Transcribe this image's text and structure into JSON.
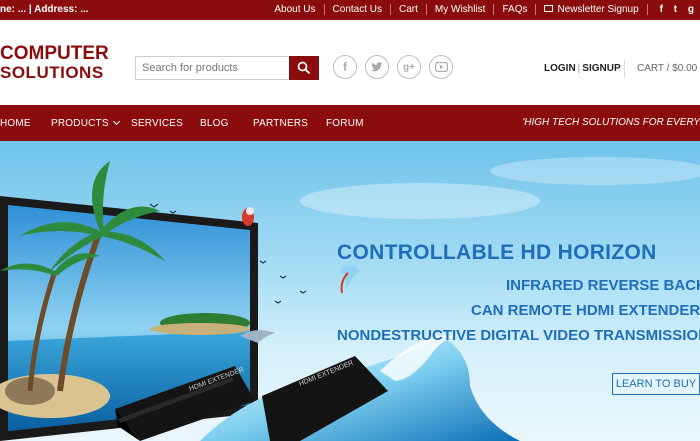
{
  "topbar": {
    "contact_text": "ne: ... | Address: ...",
    "links": [
      "About Us",
      "Contact Us",
      "Cart",
      "My Wishlist",
      "FAQs"
    ],
    "newsletter": "Newsletter Signup",
    "social_glyphs": [
      "f",
      "t",
      "g"
    ]
  },
  "header": {
    "logo_line1": "COMPUTER",
    "logo_line2": "SOLUTIONS",
    "search_placeholder": "Search for products",
    "social_icons": [
      "facebook-icon",
      "twitter-icon",
      "google-plus-icon",
      "youtube-icon"
    ],
    "login": "LOGIN",
    "signup": "SIGNUP",
    "cart": "CART / $0.00"
  },
  "nav": {
    "items": [
      "HOME",
      "PRODUCTS",
      "SERVICES",
      "BLOG",
      "PARTNERS",
      "FORUM"
    ],
    "tagline": "'HIGH TECH SOLUTIONS FOR EVERY"
  },
  "banner": {
    "headline": "CONTROLLABLE HD HORIZON",
    "line1": "INFRARED REVERSE BACK",
    "line2": "CAN REMOTE HDMI EXTENDER",
    "line3": "NONDESTRUCTIVE DIGITAL VIDEO TRANSMISSION",
    "cta": "LEARN TO BUY",
    "device_label": "HDMI EXTENDER"
  },
  "colors": {
    "brand": "#8b0c0c",
    "banner_text": "#1d6fb8"
  }
}
